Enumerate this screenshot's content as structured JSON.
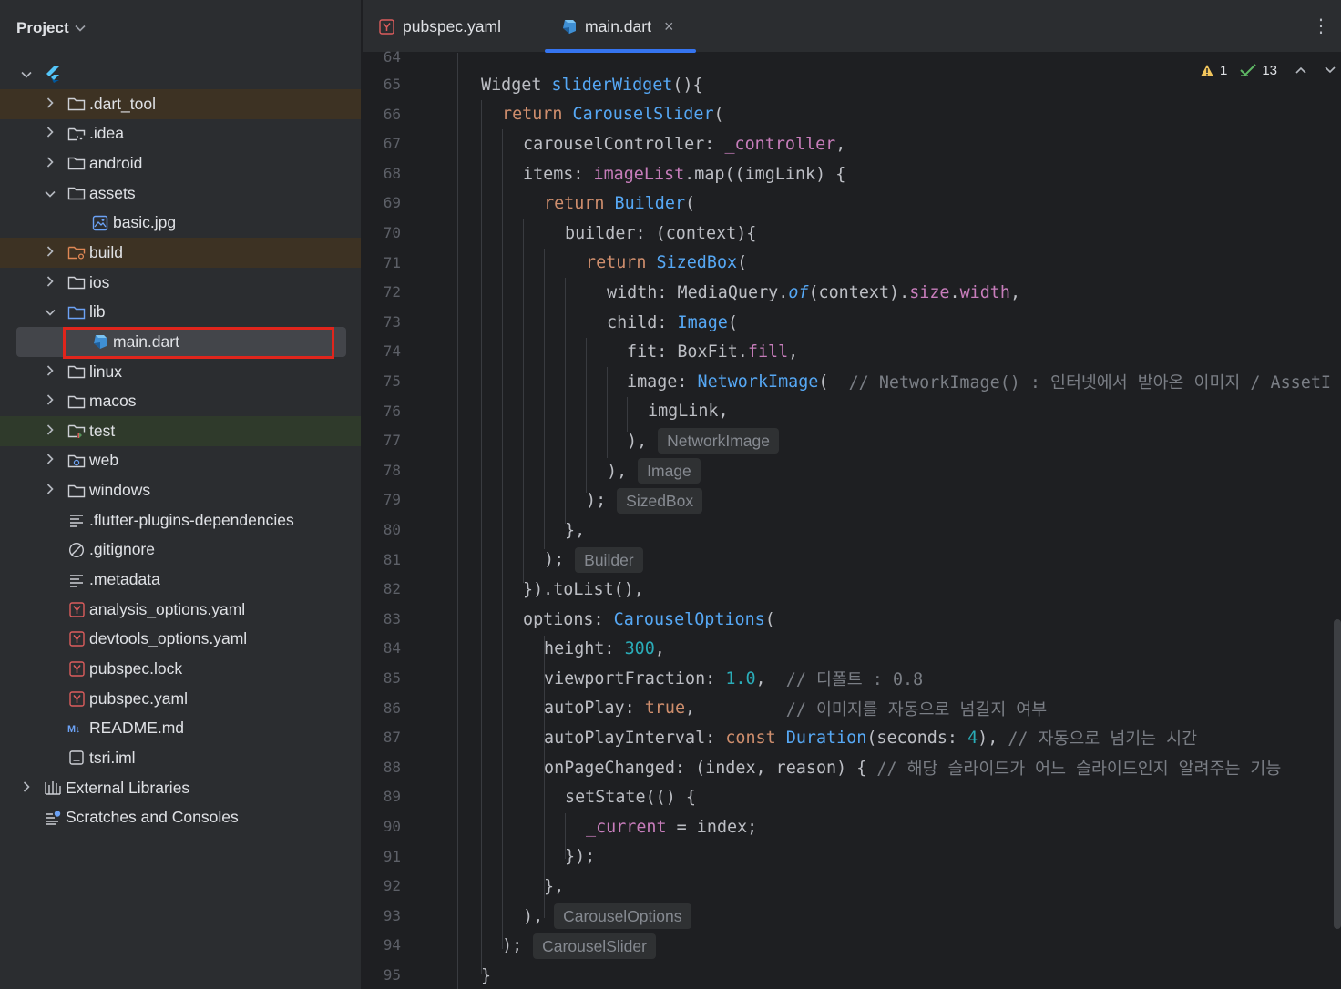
{
  "project": {
    "title": "Project",
    "tree": [
      {
        "label": "",
        "icon": "flutter-icon",
        "arrow": "down",
        "level": 0
      },
      {
        "label": ".dart_tool",
        "icon": "folder-icon",
        "arrow": "right",
        "level": 1,
        "style": "excluded"
      },
      {
        "label": ".idea",
        "icon": "folder-config-icon",
        "arrow": "right",
        "level": 1
      },
      {
        "label": "android",
        "icon": "folder-icon",
        "arrow": "right",
        "level": 1
      },
      {
        "label": "assets",
        "icon": "folder-icon",
        "arrow": "down",
        "level": 1
      },
      {
        "label": "basic.jpg",
        "icon": "image-file-icon",
        "arrow": "",
        "level": 2
      },
      {
        "label": "build",
        "icon": "folder-excluded-icon",
        "arrow": "right",
        "level": 1,
        "style": "excluded"
      },
      {
        "label": "ios",
        "icon": "folder-icon",
        "arrow": "right",
        "level": 1
      },
      {
        "label": "lib",
        "icon": "folder-source-icon",
        "arrow": "down",
        "level": 1
      },
      {
        "label": "main.dart",
        "icon": "dart-file-icon",
        "arrow": "",
        "level": 2,
        "style": "selected"
      },
      {
        "label": "linux",
        "icon": "folder-icon",
        "arrow": "right",
        "level": 1
      },
      {
        "label": "macos",
        "icon": "folder-icon",
        "arrow": "right",
        "level": 1
      },
      {
        "label": "test",
        "icon": "folder-test-icon",
        "arrow": "right",
        "level": 1,
        "style": "testdir"
      },
      {
        "label": "web",
        "icon": "folder-web-icon",
        "arrow": "right",
        "level": 1
      },
      {
        "label": "windows",
        "icon": "folder-icon",
        "arrow": "right",
        "level": 1
      },
      {
        "label": ".flutter-plugins-dependencies",
        "icon": "text-file-icon",
        "arrow": "",
        "level": 1
      },
      {
        "label": ".gitignore",
        "icon": "ignore-file-icon",
        "arrow": "",
        "level": 1
      },
      {
        "label": ".metadata",
        "icon": "text-file-icon",
        "arrow": "",
        "level": 1
      },
      {
        "label": "analysis_options.yaml",
        "icon": "yaml-file-icon",
        "arrow": "",
        "level": 1
      },
      {
        "label": "devtools_options.yaml",
        "icon": "yaml-file-icon",
        "arrow": "",
        "level": 1
      },
      {
        "label": "pubspec.lock",
        "icon": "yaml-file-icon",
        "arrow": "",
        "level": 1
      },
      {
        "label": "pubspec.yaml",
        "icon": "yaml-file-icon",
        "arrow": "",
        "level": 1
      },
      {
        "label": "README.md",
        "icon": "markdown-file-icon",
        "arrow": "",
        "level": 1
      },
      {
        "label": "tsri.iml",
        "icon": "iml-file-icon",
        "arrow": "",
        "level": 1
      },
      {
        "label": "External Libraries",
        "icon": "library-icon",
        "arrow": "right",
        "level": 0
      },
      {
        "label": "Scratches and Consoles",
        "icon": "scratches-icon",
        "arrow": "",
        "level": 0
      }
    ]
  },
  "tabs": [
    {
      "label": "pubspec.yaml",
      "icon": "yaml-file-icon",
      "active": false
    },
    {
      "label": "main.dart",
      "icon": "dart-file-icon",
      "active": true,
      "close": "×"
    }
  ],
  "tabs_menu": "⋮",
  "inspections": {
    "warnings": "1",
    "checks": "13"
  },
  "editor": {
    "first_partial_line": "64",
    "line_numbers": [
      "65",
      "66",
      "67",
      "68",
      "69",
      "70",
      "71",
      "72",
      "73",
      "74",
      "75",
      "76",
      "77",
      "78",
      "79",
      "80",
      "81",
      "82",
      "83",
      "84",
      "85",
      "86",
      "87",
      "88",
      "89",
      "90",
      "91",
      "92",
      "93",
      "94",
      "95"
    ],
    "hints": {
      "l77": "NetworkImage",
      "l78": "Image",
      "l79": "SizedBox",
      "l81": "Builder",
      "l93": "CarouselOptions",
      "l94": "CarouselSlider"
    },
    "comments": {
      "l75": "// NetworkImage() : 인터넷에서 받아온 이미지 / AssetI",
      "l85": "// 디폴트 : 0.8",
      "l86": "// 이미지를 자동으로 넘길지 여부",
      "l87": "// 자동으로 넘기는 시간",
      "l88": "// 해당 슬라이드가 어느 슬라이드인지 알려주는 기능"
    }
  },
  "colors": {
    "keyword": "#cf8e6d",
    "function": "#56a8f5",
    "property": "#c77dbb",
    "number": "#2aacb8",
    "comment": "#7a7e85",
    "highlight_box": "#e0251c",
    "tab_underline": "#3574f0"
  }
}
